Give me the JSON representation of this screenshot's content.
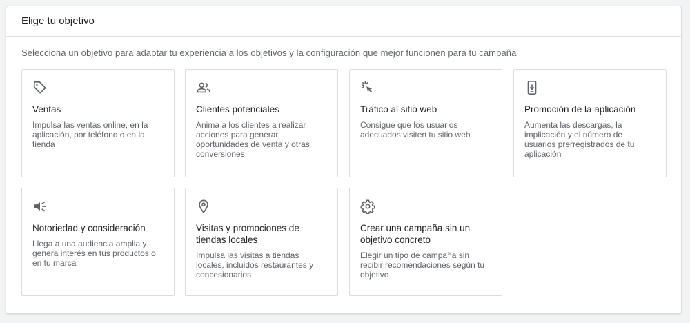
{
  "header": {
    "title": "Elige tu objetivo"
  },
  "subtitle": "Selecciona un objetivo para adaptar tu experiencia a los objetivos y la configuración que mejor funcionen para tu campaña",
  "cards": [
    {
      "icon": "tag-icon",
      "title": "Ventas",
      "desc": "Impulsa las ventas online, en la aplicación, por teléfono o en la tienda"
    },
    {
      "icon": "people-icon",
      "title": "Clientes potenciales",
      "desc": "Anima a los clientes a realizar acciones para generar oportunidades de venta y otras conversiones"
    },
    {
      "icon": "cursor-click-icon",
      "title": "Tráfico al sitio web",
      "desc": "Consigue que los usuarios adecuados visiten tu sitio web"
    },
    {
      "icon": "phone-download-icon",
      "title": "Promoción de la aplicación",
      "desc": "Aumenta las descargas, la implicación y el número de usuarios prerregistrados de tu aplicación"
    },
    {
      "icon": "speaker-icon",
      "title": "Notoriedad y consideración",
      "desc": "Llega a una audiencia amplia y genera interés en tus productos o en tu marca"
    },
    {
      "icon": "location-pin-icon",
      "title": "Visitas y promociones de tiendas locales",
      "desc": "Impulsa las visitas a tiendas locales, incluidos restaurantes y concesionarios"
    },
    {
      "icon": "gear-icon",
      "title": "Crear una campaña sin un objetivo concreto",
      "desc": "Elegir un tipo de campaña sin recibir recomendaciones según tu objetivo"
    }
  ],
  "colors": {
    "icon": "#5f6368",
    "border": "#dadce0",
    "background": "#f1f3f4"
  }
}
